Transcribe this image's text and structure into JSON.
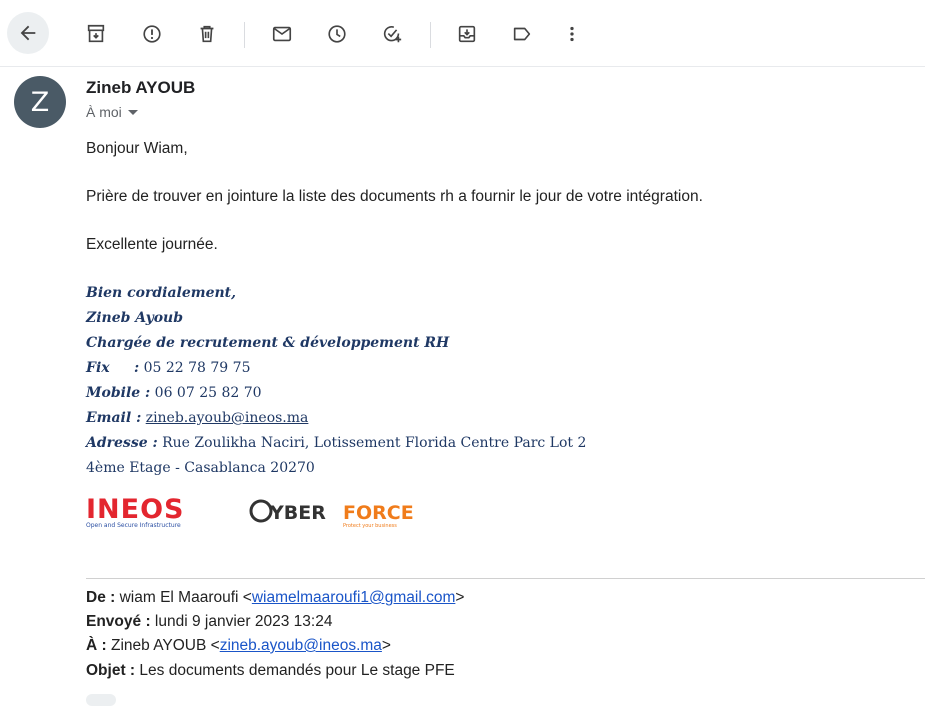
{
  "toolbar": {
    "icons": [
      "back-arrow-icon",
      "archive-icon",
      "report-spam-icon",
      "delete-icon",
      "mark-unread-icon",
      "snooze-icon",
      "add-task-icon",
      "move-to-icon",
      "label-icon",
      "more-vert-icon"
    ]
  },
  "message": {
    "avatar_letter": "Z",
    "sender": "Zineb AYOUB",
    "to": "À moi",
    "greeting": "Bonjour Wiam,",
    "line1": "Prière de trouver en jointure la liste des documents rh a fournir le jour de votre intégration.",
    "line2": "Excellente journée.",
    "signature": {
      "closing": "Bien cordialement,",
      "name": "Zineb Ayoub",
      "title": "Chargée de recrutement & développement RH",
      "fix_label": "Fix     :",
      "fix_value": " 05 22 78 79 75",
      "mobile_label": "Mobile :",
      "mobile_value": " 06 07 25 82 70",
      "email_label": "Email :",
      "email_value": "zineb.ayoub@ineos.ma",
      "address_label": "Adresse :",
      "address_value": " Rue Zoulikha Naciri, Lotissement Florida Centre Parc Lot 2",
      "address_line2": "4ème Etage - Casablanca 20270"
    },
    "logos": {
      "ineos": "INEOS",
      "ineos_tagline": "Open and Secure Infrastructure",
      "cyber": "YBER",
      "force": "FORCE",
      "cyber_tagline": "Protect your business",
      "ineos_color": "#e3262f",
      "ineos_blue": "#2b4fa3",
      "force_color": "#f07c1b"
    },
    "forwarded": {
      "from_label": "De :",
      "from_name": " wiam El Maaroufi <",
      "from_email": "wiamelmaaroufi1@gmail.com",
      "from_close": ">",
      "sent_label": "Envoyé :",
      "sent_value": " lundi 9 janvier 2023 13:24",
      "to_label": "À :",
      "to_name": " Zineb AYOUB <",
      "to_email": "zineb.ayoub@ineos.ma",
      "to_close": ">",
      "subject_label": "Objet :",
      "subject_value": " Les documents demandés pour Le stage PFE"
    }
  }
}
